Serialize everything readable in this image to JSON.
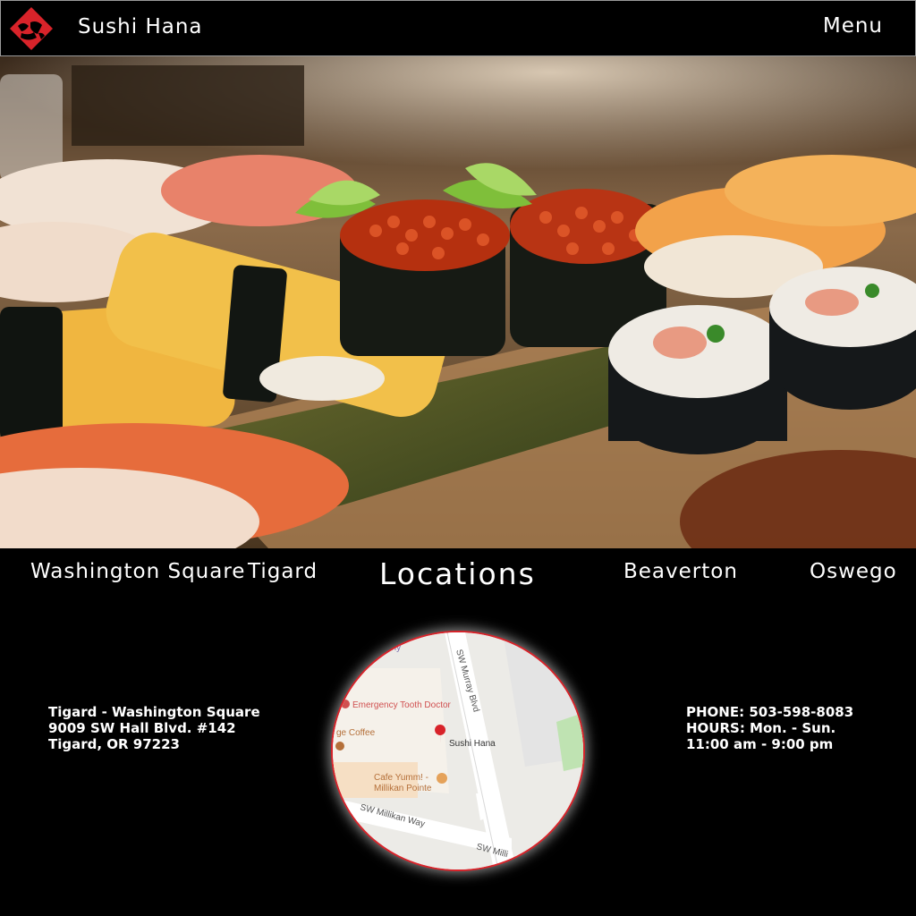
{
  "header": {
    "brand": "Sushi Hana",
    "menu_label": "Menu",
    "logo_icon": "sushi-hana-logo-icon",
    "accent_color": "#d8232a"
  },
  "hero": {
    "image": "sushi-platter-photo"
  },
  "locations_nav": {
    "title": "Locations",
    "items": [
      {
        "label": "Washington Square"
      },
      {
        "label": "Tigard"
      },
      {
        "label": "Beaverton"
      },
      {
        "label": "Oswego"
      }
    ]
  },
  "address": {
    "name": "Tigard - Washington Square",
    "street": "9009 SW Hall Blvd. #142",
    "city": "Tigard, OR 97223"
  },
  "contact": {
    "phone": "PHONE: 503-598-8083",
    "hours_days": "HOURS: Mon. - Sun.",
    "hours_time": "11:00 am - 9:00 pm"
  },
  "map": {
    "labels": {
      "street_murray": "SW Murray Blvd",
      "emergency": "Emergency Tooth Doctor",
      "coffee": "ge Coffee",
      "sushi": "Sushi Hana",
      "cafe_line1": "Cafe Yumm! -",
      "cafe_line2": "Millikan Pointe",
      "street_millikan": "SW Millikan Way",
      "street_millikan2": "SW Milli",
      "top_fragment": "any"
    }
  }
}
